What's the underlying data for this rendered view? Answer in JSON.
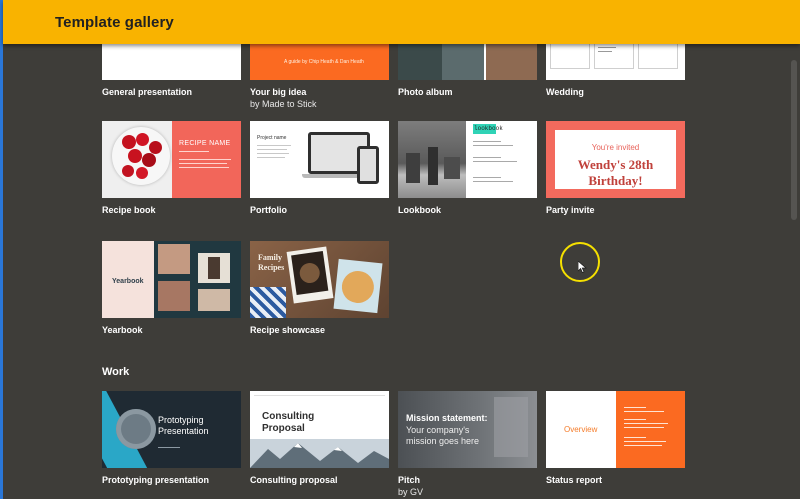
{
  "window": {
    "title": "Template gallery"
  },
  "sections": {
    "work_title": "Work"
  },
  "tiles": {
    "general": {
      "label": "General presentation"
    },
    "bigidea": {
      "label": "Your big idea",
      "sublabel": "by Made to Stick",
      "thumb_text": "A guide by Chip Heath & Dan Heath"
    },
    "photoalbum": {
      "label": "Photo album"
    },
    "wedding": {
      "label": "Wedding"
    },
    "recipebook": {
      "label": "Recipe book",
      "thumb_title": "RECIPE NAME"
    },
    "portfolio": {
      "label": "Portfolio",
      "thumb_title": "Project name"
    },
    "lookbook": {
      "label": "Lookbook",
      "thumb_tag": "lookbook"
    },
    "partyinvite": {
      "label": "Party invite",
      "thumb_small": "You're invited",
      "thumb_big_1": "Wendy's 28th",
      "thumb_big_2": "Birthday!"
    },
    "yearbook": {
      "label": "Yearbook",
      "thumb_title": "Yearbook"
    },
    "recipeshowcase": {
      "label": "Recipe showcase",
      "thumb_title_1": "Family",
      "thumb_title_2": "Recipes"
    },
    "prototyping": {
      "label": "Prototyping presentation",
      "thumb_title_1": "Prototyping",
      "thumb_title_2": "Presentation"
    },
    "consulting": {
      "label": "Consulting proposal",
      "thumb_title_1": "Consulting",
      "thumb_title_2": "Proposal"
    },
    "pitch": {
      "label": "Pitch",
      "sublabel": "by GV",
      "thumb_line_1": "Mission statement:",
      "thumb_line_2": "Your company's",
      "thumb_line_3": "mission goes here"
    },
    "statusreport": {
      "label": "Status report",
      "thumb_title": "Overview"
    }
  },
  "colors": {
    "topbar": "#f9b300",
    "background": "#3e3d39",
    "accent_orange": "#fb6a21",
    "coral": "#f56b5e"
  }
}
